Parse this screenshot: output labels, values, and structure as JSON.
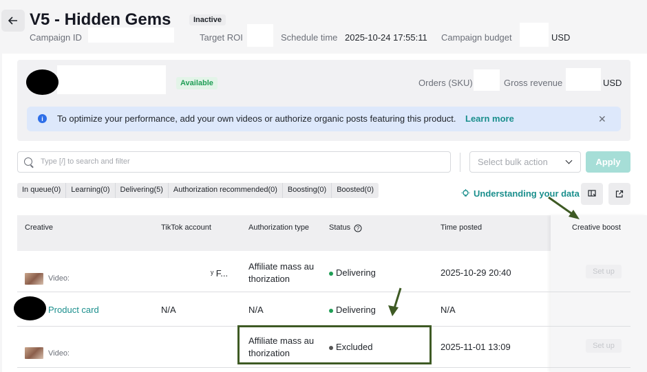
{
  "header": {
    "title": "V5 - Hidden Gems",
    "status": "Inactive",
    "campaign_id_label": "Campaign ID",
    "target_roi_label": "Target ROI",
    "schedule_time_label": "Schedule time",
    "schedule_time_value": "2025-10-24 17:55:11",
    "budget_label": "Campaign budget",
    "budget_currency": "USD"
  },
  "product": {
    "availability": "Available",
    "orders_label": "Orders (SKU)",
    "gross_revenue_label": "Gross revenue",
    "currency": "USD"
  },
  "banner": {
    "text": "To optimize your performance, add your own videos or authorize organic posts featuring this product.",
    "link": "Learn more"
  },
  "search": {
    "placeholder": "Type [/] to search and filter"
  },
  "bulk": {
    "placeholder": "Select bulk action",
    "apply_label": "Apply"
  },
  "tabs": [
    {
      "label": "In queue(0)"
    },
    {
      "label": "Learning(0)"
    },
    {
      "label": "Delivering(5)"
    },
    {
      "label": "Authorization recommended(0)"
    },
    {
      "label": "Boosting(0)"
    },
    {
      "label": "Boosted(0)"
    }
  ],
  "understanding_link": "Understanding your data",
  "table": {
    "columns": {
      "creative": "Creative",
      "account": "TikTok account",
      "auth_type": "Authorization type",
      "status": "Status",
      "time_posted": "Time posted",
      "creative_boost": "Creative boost"
    },
    "rows": [
      {
        "creative": "Video:",
        "account": "ʸ F...",
        "auth_line1": "Affiliate mass au",
        "auth_line2": "thorization",
        "status": "Delivering",
        "time_posted": "2025-10-29 20:40",
        "boost": "Set up"
      },
      {
        "creative": "Product card",
        "account": "N/A",
        "auth_type": "N/A",
        "status": "Delivering",
        "time_posted": "N/A"
      },
      {
        "creative": "Video:",
        "auth_line1": "Affiliate mass au",
        "auth_line2": "thorization",
        "status": "Excluded",
        "time_posted": "2025-11-01 13:09",
        "boost": "Set up"
      }
    ]
  },
  "colors": {
    "accent": "#1b8f8d",
    "delivering": "#1f9d55",
    "excluded": "#555555",
    "annotation": "#3e5a24"
  }
}
